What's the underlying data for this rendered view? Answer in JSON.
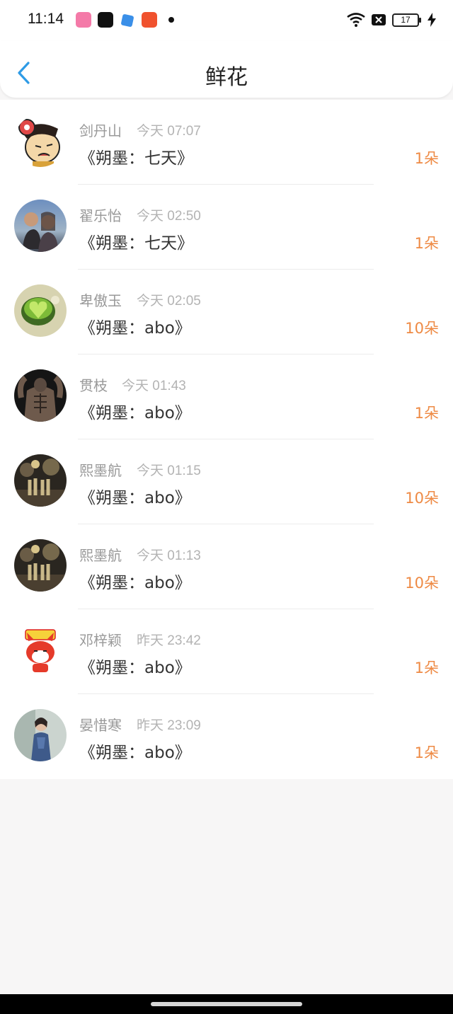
{
  "status": {
    "time": "11:14",
    "battery": "17"
  },
  "header": {
    "title": "鲜花"
  },
  "gifts": [
    {
      "name": "剑丹山",
      "when": "今天 07:07",
      "book": "《朔墨：七天》",
      "count": "1朵"
    },
    {
      "name": "翟乐怡",
      "when": "今天 02:50",
      "book": "《朔墨：七天》",
      "count": "1朵"
    },
    {
      "name": "卑傲玉",
      "when": "今天 02:05",
      "book": "《朔墨：abo》",
      "count": "10朵"
    },
    {
      "name": "贯枝",
      "when": "今天 01:43",
      "book": "《朔墨：abo》",
      "count": "1朵"
    },
    {
      "name": "熙墨航",
      "when": "今天 01:15",
      "book": "《朔墨：abo》",
      "count": "10朵"
    },
    {
      "name": "熙墨航",
      "when": "今天 01:13",
      "book": "《朔墨：abo》",
      "count": "10朵"
    },
    {
      "name": "邓梓颖",
      "when": "昨天 23:42",
      "book": "《朔墨：abo》",
      "count": "1朵"
    },
    {
      "name": "晏惜寒",
      "when": "昨天 23:09",
      "book": "《朔墨：abo》",
      "count": "1朵"
    }
  ],
  "colors": {
    "accent_blue": "#2e9be6",
    "count_orange": "#ee8a44"
  }
}
